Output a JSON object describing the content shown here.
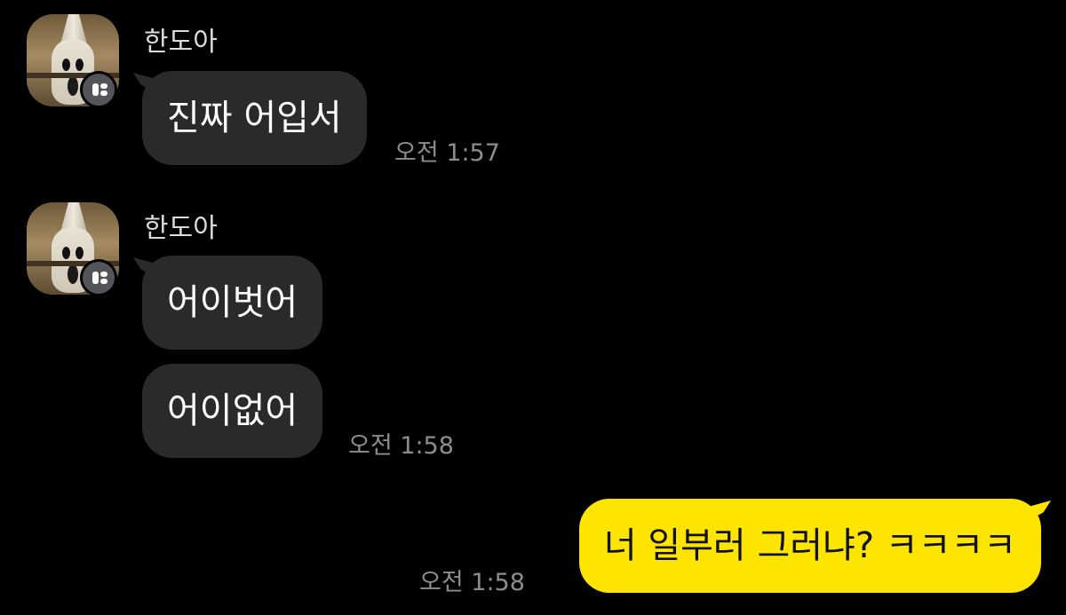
{
  "colors": {
    "background": "#000000",
    "incoming_bubble": "#2a2a2a",
    "outgoing_bubble": "#fee500",
    "timestamp": "#8d8d8d"
  },
  "messages": [
    {
      "sender": "한도아",
      "bubbles": [
        "진짜 어입서"
      ],
      "time": "오전 1:57"
    },
    {
      "sender": "한도아",
      "bubbles": [
        "어이벗어",
        "어이없어"
      ],
      "time": "오전 1:58"
    }
  ],
  "outgoing": {
    "text": "너 일부러 그러냐? ㅋㅋㅋㅋ",
    "time": "오전 1:58"
  }
}
